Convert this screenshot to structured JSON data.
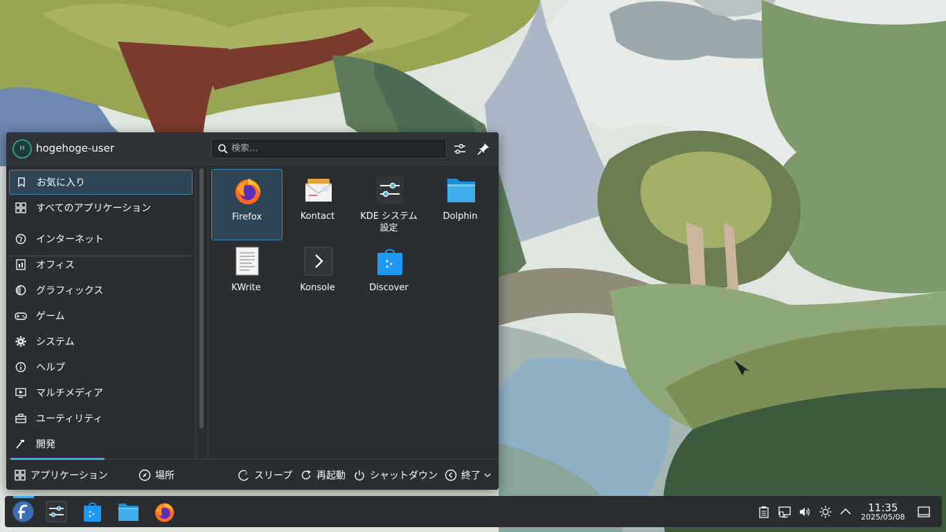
{
  "launcher": {
    "username": "hogehoge-user",
    "avatar_letter": "H",
    "search_placeholder": "検索...",
    "categories": [
      {
        "label": "お気に入り",
        "icon": "bookmark-icon",
        "active": true
      },
      {
        "label": "すべてのアプリケーション",
        "icon": "grid-icon"
      },
      {
        "label": "インターネット",
        "icon": "globe-icon"
      },
      {
        "label": "オフィス",
        "icon": "office-icon"
      },
      {
        "label": "グラフィックス",
        "icon": "graphics-icon"
      },
      {
        "label": "ゲーム",
        "icon": "gamepad-icon"
      },
      {
        "label": "システム",
        "icon": "gear-icon"
      },
      {
        "label": "ヘルプ",
        "icon": "info-icon"
      },
      {
        "label": "マルチメディア",
        "icon": "multimedia-icon"
      },
      {
        "label": "ユーティリティ",
        "icon": "toolbox-icon"
      },
      {
        "label": "開発",
        "icon": "hammer-icon"
      }
    ],
    "apps": [
      {
        "label": "Firefox",
        "icon": "firefox-icon",
        "selected": true
      },
      {
        "label": "Kontact",
        "icon": "kontact-icon"
      },
      {
        "label": "KDE システム\n設定",
        "icon": "system-settings-icon"
      },
      {
        "label": "Dolphin",
        "icon": "folder-icon"
      },
      {
        "label": "KWrite",
        "icon": "kwrite-icon"
      },
      {
        "label": "Konsole",
        "icon": "terminal-icon"
      },
      {
        "label": "Discover",
        "icon": "discover-icon"
      }
    ],
    "footer": {
      "applications": "アプリケーション",
      "places": "場所",
      "sleep": "スリープ",
      "restart": "再起動",
      "shutdown": "シャットダウン",
      "leave": "終了"
    }
  },
  "taskbar": {
    "pinned": [
      "fedora-icon",
      "system-settings-icon",
      "discover-icon",
      "folder-icon",
      "firefox-icon"
    ],
    "tray": [
      "clipboard-icon",
      "network-icon",
      "volume-icon",
      "brightness-icon",
      "chevron-up-icon"
    ],
    "time": "11:35",
    "date": "2025/05/08"
  },
  "colors": {
    "panel_bg": "#2a2e32",
    "accent": "#3daee9",
    "selection": "#2f4556"
  }
}
